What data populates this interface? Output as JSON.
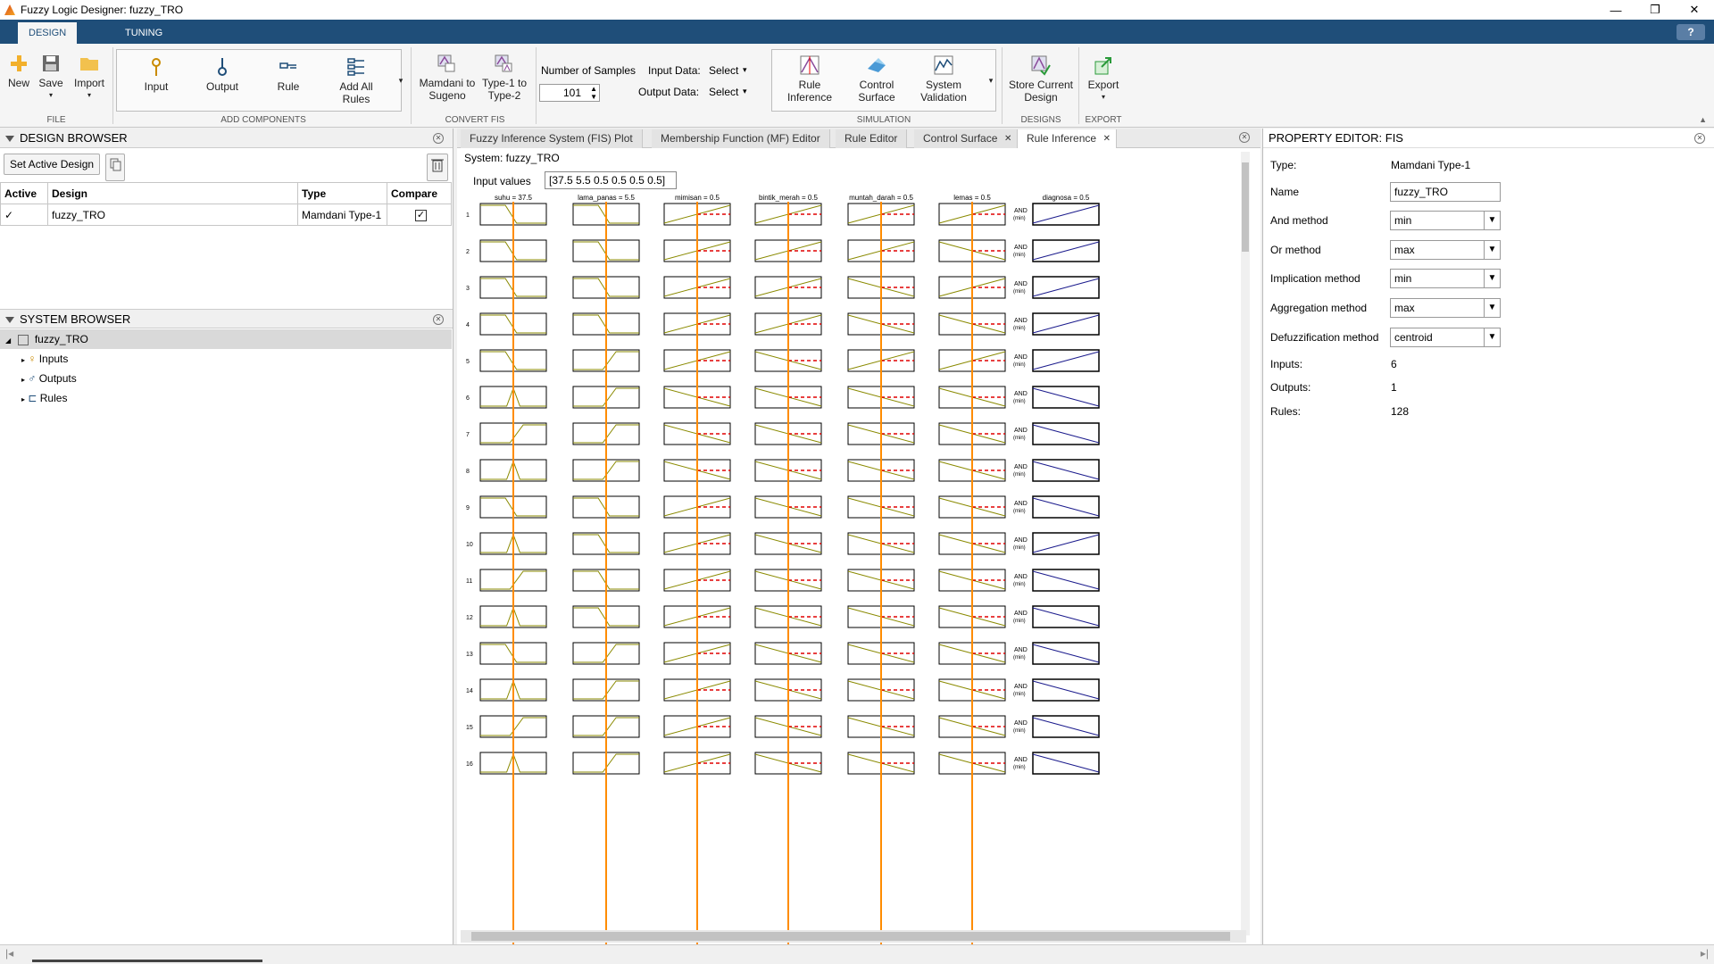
{
  "window": {
    "title": "Fuzzy Logic Designer: fuzzy_TRO",
    "controls": [
      "—",
      "❐",
      "✕"
    ]
  },
  "tabs": {
    "design": "DESIGN",
    "tuning": "TUNING",
    "help": "?"
  },
  "ribbon": {
    "file": {
      "new": "New",
      "save": "Save",
      "import": "Import",
      "group": "FILE"
    },
    "add": {
      "input": "Input",
      "output": "Output",
      "rule": "Rule",
      "add_all_rules": "Add All Rules",
      "group": "ADD COMPONENTS"
    },
    "convert": {
      "m2s": "Mamdani to Sugeno",
      "t1t2": "Type-1 to Type-2",
      "group": "CONVERT FIS"
    },
    "samples": {
      "label": "Number of Samples",
      "value": "101",
      "input_label": "Input Data:",
      "input_value": "Select",
      "output_label": "Output Data:",
      "output_value": "Select"
    },
    "sim": {
      "rule_inference": "Rule Inference",
      "control_surface": "Control Surface",
      "system_validation": "System Validation",
      "group": "SIMULATION"
    },
    "designs": {
      "store": "Store Current Design",
      "group": "DESIGNS"
    },
    "export": {
      "label": "Export",
      "group": "EXPORT"
    }
  },
  "design_browser": {
    "title": "DESIGN BROWSER",
    "set_active": "Set Active Design",
    "headers": [
      "Active",
      "Design",
      "Type",
      "Compare"
    ],
    "rows": [
      {
        "active": "✓",
        "design": "fuzzy_TRO",
        "type": "Mamdani Type-1",
        "compare": "✓"
      }
    ]
  },
  "system_browser": {
    "title": "SYSTEM BROWSER",
    "root": "fuzzy_TRO",
    "items": [
      "Inputs",
      "Outputs",
      "Rules"
    ]
  },
  "center_tabs": [
    "Fuzzy Inference System (FIS) Plot",
    "Membership Function (MF) Editor",
    "Rule Editor",
    "Control Surface",
    "Rule Inference"
  ],
  "rule_inference": {
    "system_label": "System: fuzzy_TRO",
    "input_values_label": "Input values",
    "input_values": "[37.5 5.5 0.5 0.5 0.5 0.5]",
    "inputs": [
      "suhu = 37.5",
      "lama_panas = 5.5",
      "mimisan = 0.5",
      "bintik_merah = 0.5",
      "muntah_darah = 0.5",
      "lemas = 0.5"
    ],
    "output": "diagnosa = 0.5",
    "and_label": "AND",
    "min_label": "(min)",
    "row_numbers": [
      "1",
      "2",
      "3",
      "4",
      "5",
      "6",
      "7",
      "8",
      "9",
      "10",
      "11",
      "12",
      "13",
      "14",
      "15",
      "16"
    ],
    "suhu_mf": [
      "dec",
      "dec",
      "dec",
      "dec",
      "dec",
      "tri",
      "inc",
      "tri",
      "dec",
      "tri",
      "inc",
      "tri",
      "dec",
      "tri",
      "inc",
      "tri"
    ],
    "lama_mf": [
      "dec",
      "dec",
      "dec",
      "dec",
      "inc",
      "inc",
      "inc",
      "inc",
      "dec",
      "dec",
      "dec",
      "dec",
      "inc",
      "inc",
      "inc",
      "inc"
    ],
    "mimisan_mf": [
      "inc",
      "inc",
      "inc",
      "inc",
      "inc",
      "dec",
      "dec",
      "dec",
      "inc",
      "inc",
      "inc",
      "inc",
      "inc",
      "inc",
      "inc",
      "inc"
    ],
    "bintik_mf": [
      "inc",
      "inc",
      "inc",
      "inc",
      "dec",
      "dec",
      "dec",
      "dec",
      "dec",
      "dec",
      "dec",
      "dec",
      "dec",
      "dec",
      "dec",
      "dec"
    ],
    "muntah_mf": [
      "inc",
      "inc",
      "dec",
      "dec",
      "inc",
      "dec",
      "dec",
      "dec",
      "dec",
      "dec",
      "dec",
      "dec",
      "dec",
      "dec",
      "dec",
      "dec"
    ],
    "lemas_mf": [
      "inc",
      "dec",
      "inc",
      "dec",
      "inc",
      "dec",
      "dec",
      "dec",
      "dec",
      "dec",
      "dec",
      "dec",
      "dec",
      "dec",
      "dec",
      "dec"
    ],
    "out_mf": [
      "inc",
      "inc",
      "inc",
      "inc",
      "inc",
      "dec",
      "dec",
      "dec",
      "dec",
      "inc",
      "dec",
      "dec",
      "dec",
      "dec",
      "dec",
      "dec"
    ]
  },
  "property_editor": {
    "title": "PROPERTY EDITOR: FIS",
    "type_label": "Type:",
    "type_value": "Mamdani Type-1",
    "name_label": "Name",
    "name_value": "fuzzy_TRO",
    "and_label": "And method",
    "and_value": "min",
    "or_label": "Or method",
    "or_value": "max",
    "imp_label": "Implication method",
    "imp_value": "min",
    "agg_label": "Aggregation method",
    "agg_value": "max",
    "defuzz_label": "Defuzzification method",
    "defuzz_value": "centroid",
    "inputs_label": "Inputs:",
    "inputs_value": "6",
    "outputs_label": "Outputs:",
    "outputs_value": "1",
    "rules_label": "Rules:",
    "rules_value": "128"
  },
  "colors": {
    "accent": "#1f4e79",
    "mf": "#8a8a00",
    "input_line": "#ff8c00",
    "dash": "#e00000",
    "out_mf": "#1a1a8c"
  }
}
